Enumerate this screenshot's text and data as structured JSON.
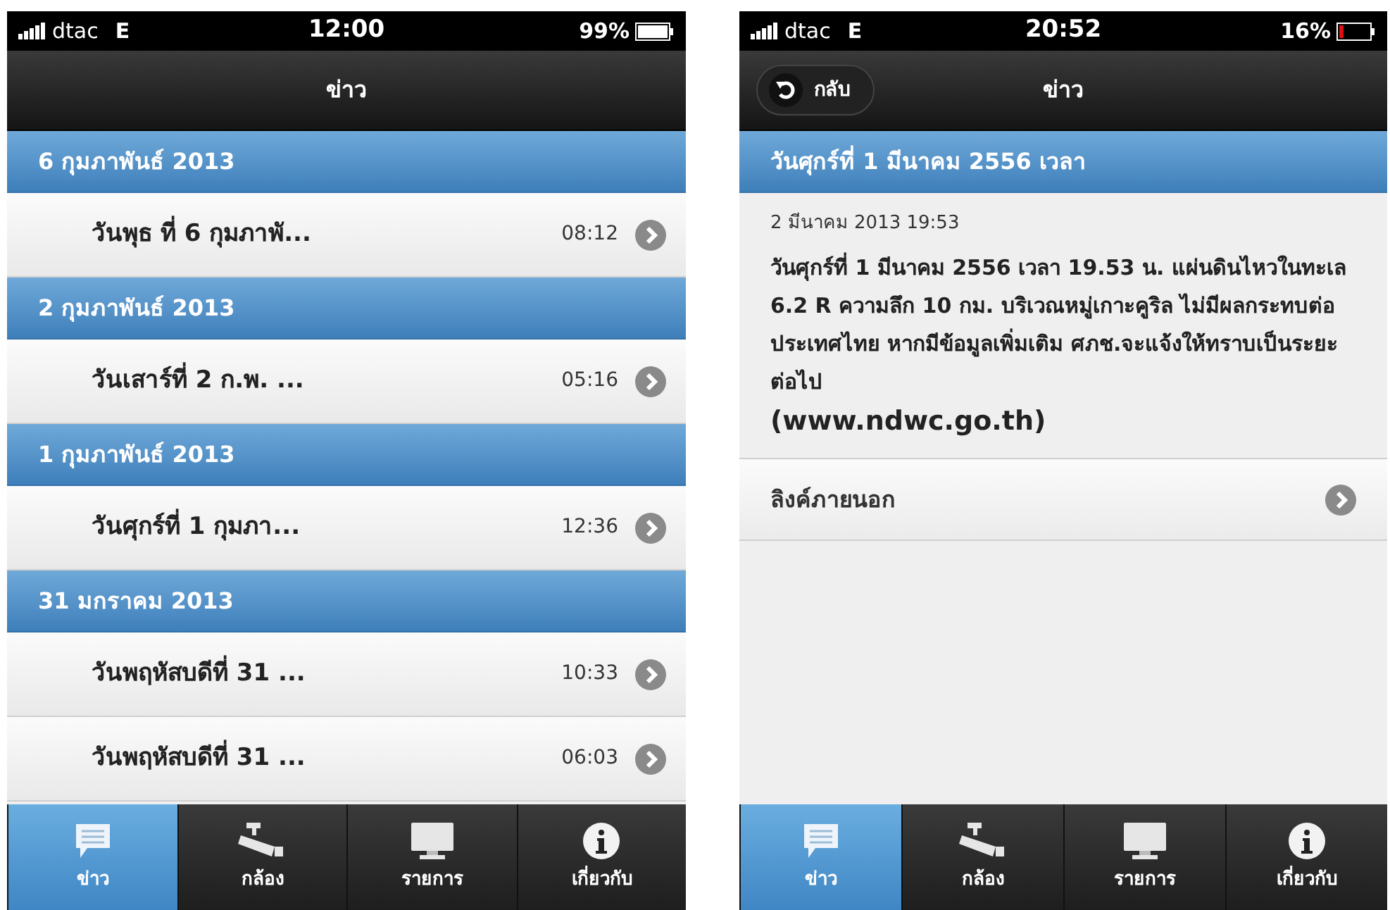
{
  "phones": [
    {
      "status": {
        "carrier": "dtac",
        "network": "E",
        "time": "12:00",
        "battery": "99%",
        "battery_low": false
      },
      "nav": {
        "title": "ข่าว"
      },
      "sections": [
        {
          "header": "6 กุมภาพันธ์ 2013",
          "items": [
            {
              "title": "วันพุธ ที่ 6 กุมภาพั...",
              "time": "08:12"
            }
          ]
        },
        {
          "header": "2 กุมภาพันธ์ 2013",
          "items": [
            {
              "title": "วันเสาร์ที่ 2 ก.พ. ...",
              "time": "05:16"
            }
          ]
        },
        {
          "header": "1 กุมภาพันธ์ 2013",
          "items": [
            {
              "title": "วันศุกร์ที่ 1 กุมภา...",
              "time": "12:36"
            }
          ]
        },
        {
          "header": "31 มกราคม 2013",
          "items": [
            {
              "title": "วันพฤหัสบดีที่ 31 ...",
              "time": "10:33"
            },
            {
              "title": "วันพฤหัสบดีที่ 31 ...",
              "time": "06:03"
            }
          ]
        }
      ],
      "tabs": [
        {
          "label": "ข่าว",
          "kind": "news",
          "selected": true
        },
        {
          "label": "กล้อง",
          "kind": "camera",
          "selected": false
        },
        {
          "label": "รายการ",
          "kind": "screen",
          "selected": false
        },
        {
          "label": "เกี่ยวกับ",
          "kind": "info",
          "selected": false
        }
      ]
    },
    {
      "status": {
        "carrier": "dtac",
        "network": "E",
        "time": "20:52",
        "battery": "16%",
        "battery_low": true
      },
      "nav": {
        "title": "ข่าว",
        "back_button": "กลับ"
      },
      "detail": {
        "header": "วันศุกร์ที่ 1 มีนาคม 2556 เวลา",
        "date": "2 มีนาคม 2013 19:53",
        "body": "วันศุกร์ที่ 1 มีนาคม 2556 เวลา 19.53 น. แผ่นดินไหวในทะเล 6.2 R ความลึก 10 กม. บริเวณหมู่เกาะคูริล ไม่มีผลกระทบต่อประเทศไทย หากมีข้อมูลเพิ่มเติม ศภช.จะแจ้งให้ทราบเป็นระยะต่อไป",
        "url": "(www.ndwc.go.th)",
        "link": "ลิงค์ภายนอก"
      },
      "tabs": [
        {
          "label": "ข่าว",
          "kind": "news",
          "selected": true
        },
        {
          "label": "กล้อง",
          "kind": "camera",
          "selected": false
        },
        {
          "label": "รายการ",
          "kind": "screen",
          "selected": false
        },
        {
          "label": "เกี่ยวกับ",
          "kind": "info",
          "selected": false
        }
      ]
    }
  ]
}
